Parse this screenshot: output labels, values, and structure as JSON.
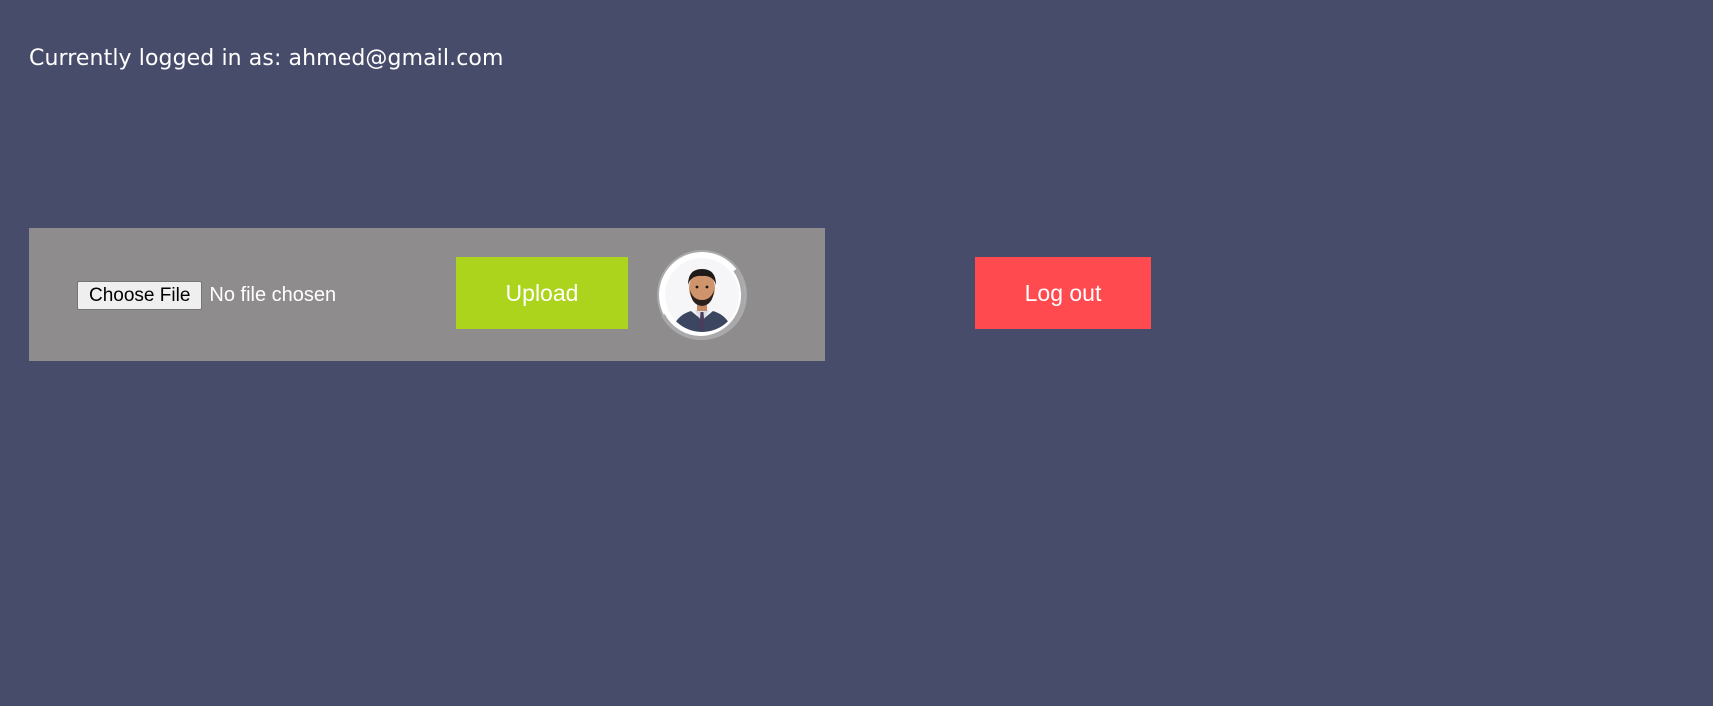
{
  "header": {
    "login_status": "Currently logged in as: ahmed@gmail.com"
  },
  "upload_panel": {
    "choose_file_label": "Choose File",
    "file_status": "No file chosen",
    "upload_label": "Upload",
    "avatar": "profile-photo-avatar"
  },
  "actions": {
    "logout_label": "Log out"
  },
  "colors": {
    "background": "#484c6b",
    "panel": "#8f8c8d",
    "upload_button": "#acd41c",
    "logout_button": "#ff4a50"
  }
}
